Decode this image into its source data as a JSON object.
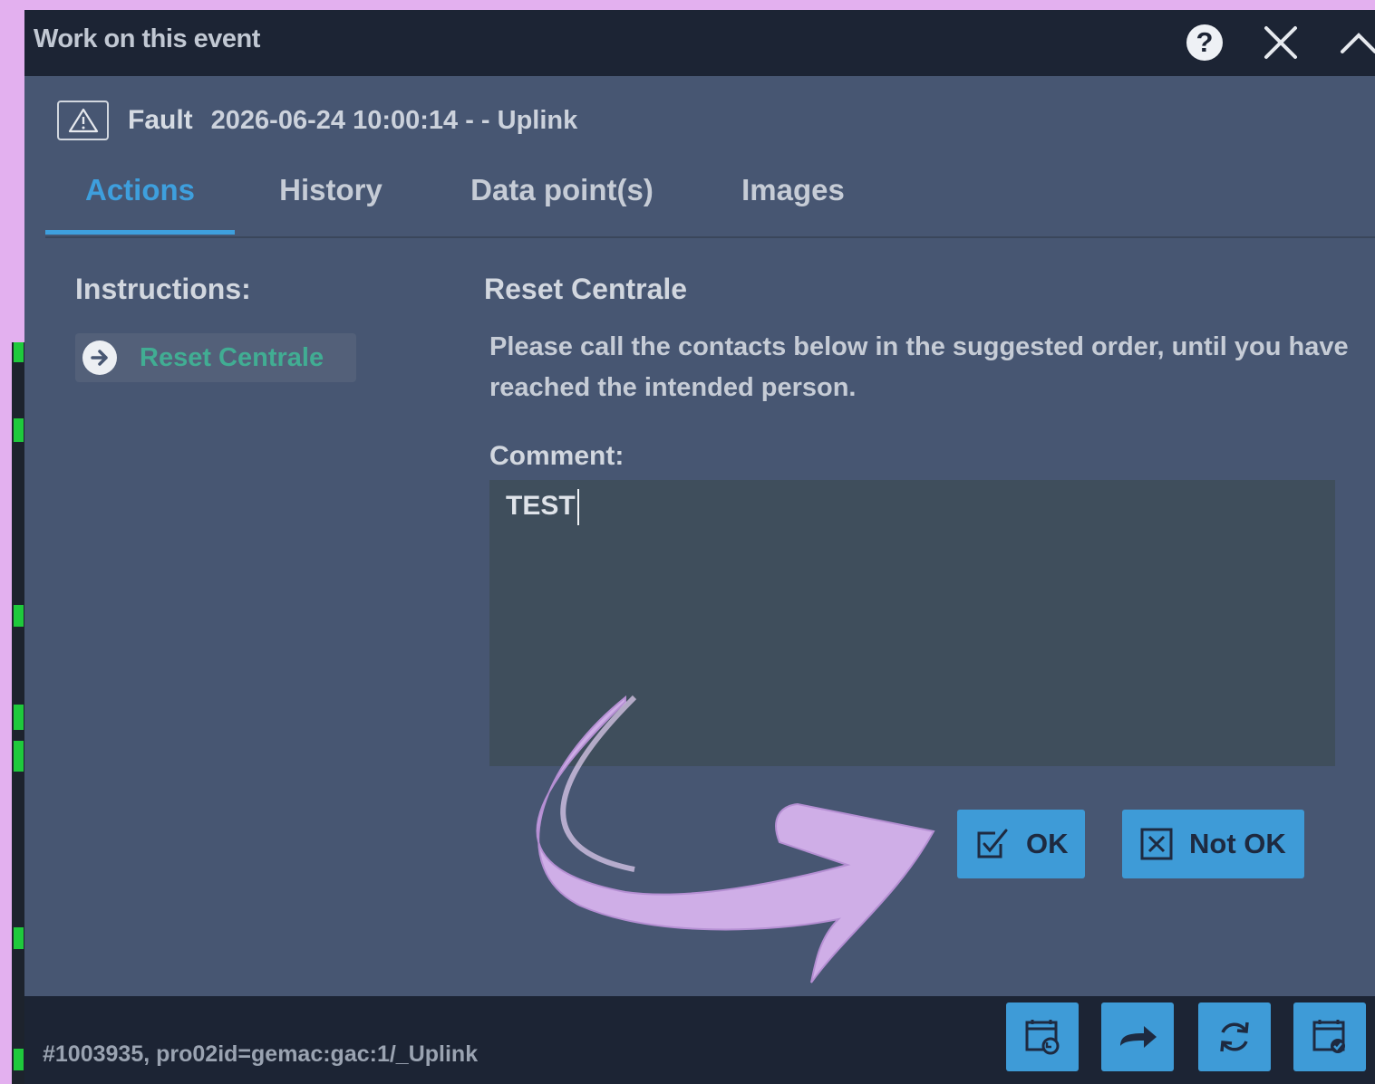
{
  "window": {
    "title": "Work on this event",
    "controls": {
      "help_glyph": "?"
    }
  },
  "event": {
    "icon": "warning-triangle-icon",
    "type": "Fault",
    "description": "2026-06-24 10:00:14 - - Uplink"
  },
  "tabs": [
    {
      "label": "Actions",
      "active": true
    },
    {
      "label": "History",
      "active": false
    },
    {
      "label": "Data point(s)",
      "active": false
    },
    {
      "label": "Images",
      "active": false
    }
  ],
  "instructions": {
    "label": "Instructions:",
    "items": [
      {
        "label": "Reset Centrale",
        "icon": "arrow-right-circle-icon"
      }
    ]
  },
  "action": {
    "title": "Reset Centrale",
    "description": "Please call the contacts below in the suggested order, until you have reached the intended person.",
    "comment_label": "Comment:",
    "comment_value": "TEST",
    "ok_label": "OK",
    "not_ok_label": "Not OK"
  },
  "footer": {
    "status": "#1003935, pro02id=gemac:gac:1/_Uplink",
    "buttons": [
      "calendar-undo-icon",
      "forward-arrow-icon",
      "refresh-icon",
      "calendar-check-icon"
    ]
  },
  "colors": {
    "page_background": "#e3b0ef",
    "titlebar": "#1c2434",
    "panel": "#475672",
    "accent": "#3e9fdd",
    "instruction_link": "#41ad93",
    "annotation_arrow": "#cfaee7"
  }
}
